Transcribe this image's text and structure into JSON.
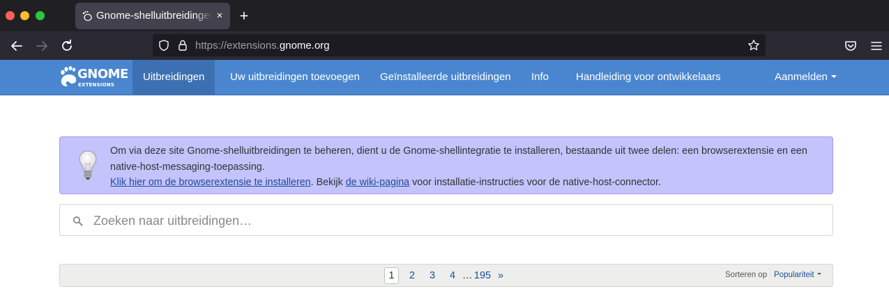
{
  "browser": {
    "tab": {
      "title": "Gnome-shelluitbreidingen",
      "close": "×"
    },
    "new_tab": "+",
    "url": {
      "prefix": "https://extensions.",
      "domain": "gnome.org"
    }
  },
  "site": {
    "logo": {
      "word": "GNOME",
      "sub": "EXTENSIONS"
    },
    "nav": {
      "items": [
        {
          "label": "Uitbreidingen",
          "active": true
        },
        {
          "label": "Uw uitbreidingen toevoegen"
        },
        {
          "label": "Geïnstalleerde uitbreidingen"
        },
        {
          "label": "Info"
        },
        {
          "label": "Handleiding voor ontwikkelaars"
        }
      ],
      "login": "Aanmelden"
    },
    "brand_color": "#4a86cf"
  },
  "notice": {
    "text": "Om via deze site Gnome-shelluitbreidingen te beheren, dient u de Gnome-shellintegratie te installeren, bestaande uit twee delen: een browserextensie en een native-host-messaging-toepassing.",
    "link1": "Klik hier om de browserextensie te installeren",
    "mid": ". Bekijk ",
    "link2": "de wiki-pagina",
    "tail": " voor installatie-instructies voor de native-host-connector.",
    "background": "#c5c3fb"
  },
  "search": {
    "placeholder": "Zoeken naar uitbreidingen…"
  },
  "pagination": {
    "pages": [
      "1",
      "2",
      "3",
      "4"
    ],
    "current": "1",
    "ellipsis": "…",
    "last": "195",
    "next": "»",
    "sort_label": "Sorteren op",
    "sort_value": "Populariteit"
  },
  "icons": [
    "back-icon",
    "forward-icon",
    "reload-icon",
    "shield-icon",
    "lock-icon",
    "star-icon",
    "pocket-icon",
    "menu-icon",
    "gnome-foot-icon",
    "lightbulb-icon",
    "search-icon"
  ]
}
